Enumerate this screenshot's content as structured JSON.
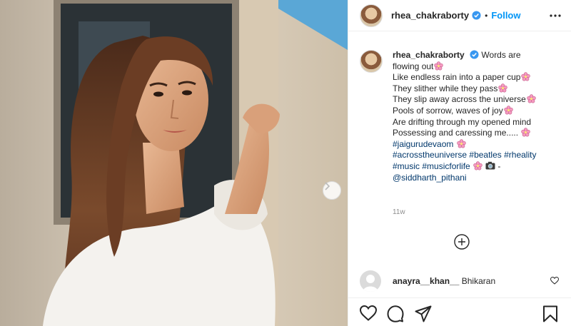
{
  "header": {
    "username": "rhea_chakraborty",
    "dot": "•",
    "follow_label": "Follow"
  },
  "caption": {
    "username": "rhea_chakraborty",
    "lines": [
      "Words are",
      "flowing out",
      "Like endless rain into a paper cup",
      "They slither while they pass",
      "They slip away across the universe",
      "Pools of sorrow, waves of joy",
      "Are drifting through my opened mind",
      "Possessing and caressing me.....",
      "#jaigurudevaom",
      "#acrosstheuniverse #beatles #rheality",
      "#music #musicforlife",
      "-",
      "@siddharth_pithani"
    ],
    "timestamp": "11w"
  },
  "comment": {
    "username": "anayra__khan__",
    "text": "Bhikaran"
  },
  "icons": {
    "next": "chevron-right-icon",
    "verified": "verified-badge-icon",
    "more": "more-options-icon",
    "load_more": "plus-circle-icon",
    "like": "heart-icon",
    "comment": "comment-icon",
    "share": "paper-plane-icon",
    "save": "bookmark-icon",
    "emoji": "pink-flower-emoji",
    "camera": "camera-emoji"
  },
  "colors": {
    "link": "#00376b",
    "follow": "#0095f6",
    "verified": "#3897f0",
    "muted": "#8e8e8e"
  }
}
